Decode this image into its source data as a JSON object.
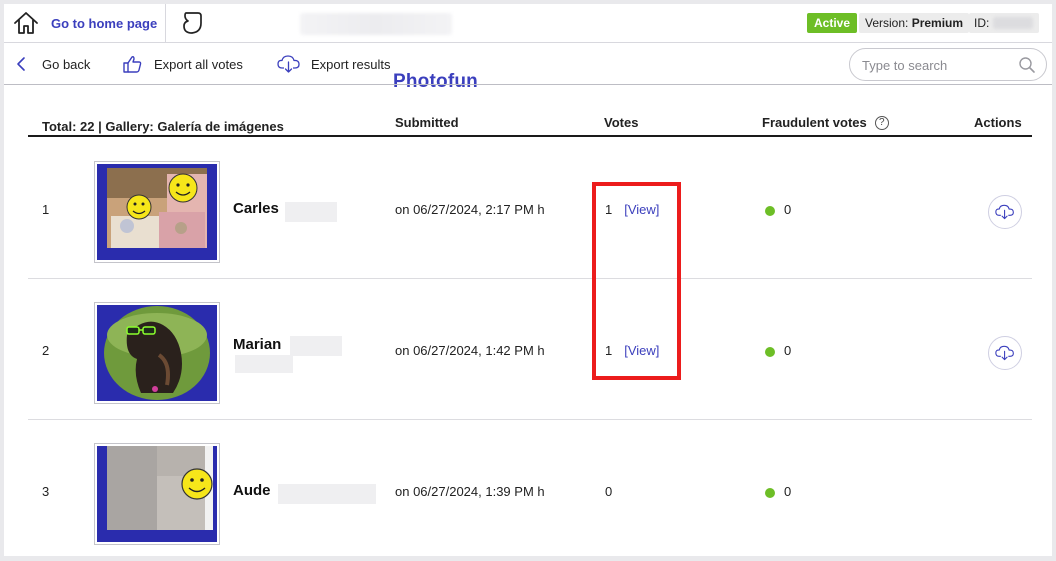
{
  "header": {
    "home_label": "Go to home page",
    "app_name": "Photofun",
    "status_badge": "Active",
    "version_prefix": "Version: ",
    "version_value": "Premium",
    "id_label": "ID:"
  },
  "toolbar": {
    "back_label": "Go back",
    "export_votes_label": "Export all votes",
    "export_results_label": "Export results",
    "search_placeholder": "Type to search"
  },
  "table": {
    "columns": {
      "total": "Total: 22 | Gallery: Galería de imágenes",
      "submitted": "Submitted",
      "votes": "Votes",
      "fraudulent": "Fraudulent votes",
      "actions": "Actions"
    },
    "rows": [
      {
        "index": "1",
        "name": "Carles",
        "submitted": "on 06/27/2024, 2:17 PM h",
        "votes": "1",
        "view_label": "[View]",
        "fraudulent": "0"
      },
      {
        "index": "2",
        "name": "Marian",
        "submitted": "on 06/27/2024, 1:42 PM h",
        "votes": "1",
        "view_label": "[View]",
        "fraudulent": "0"
      },
      {
        "index": "3",
        "name": "Aude",
        "submitted": "on 06/27/2024, 1:39 PM h",
        "votes": "0",
        "view_label": "",
        "fraudulent": "0"
      }
    ]
  },
  "colors": {
    "brand": "#3b3fbd",
    "active_green": "#6dbe26",
    "highlight_red": "#ec1c1c"
  },
  "icons": {
    "home": "home-icon",
    "logo": "photofun-logo-icon",
    "back": "chevron-left-icon",
    "export_votes": "thumbs-up-icon",
    "export_results": "cloud-download-icon",
    "search": "search-icon",
    "help": "help-circle-icon",
    "download": "cloud-download-icon"
  }
}
